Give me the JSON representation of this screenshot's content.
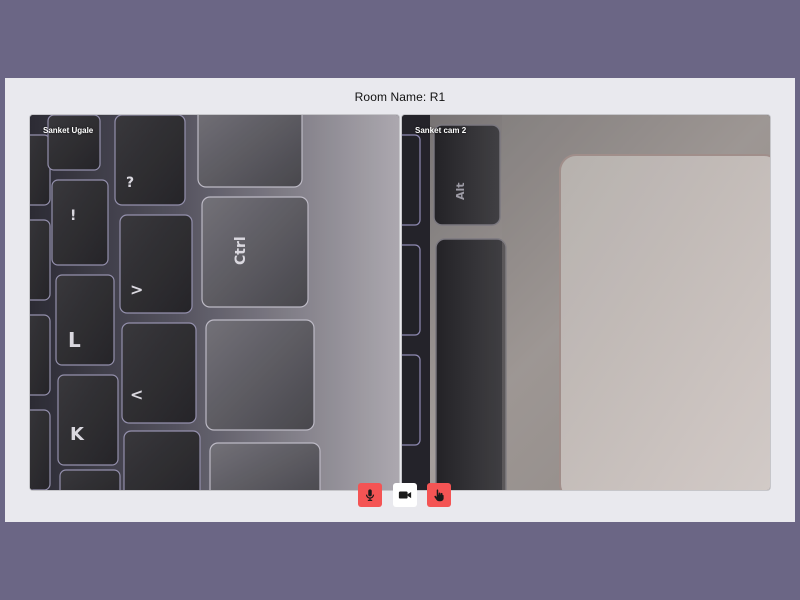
{
  "room": {
    "title": "Room Name: R1"
  },
  "participants": [
    {
      "name": "Sanket Ugale"
    },
    {
      "name": "Sanket cam 2"
    }
  ],
  "controls": {
    "mic": {
      "icon": "microphone-icon",
      "color": "#f45454",
      "state": "muted"
    },
    "camera": {
      "icon": "video-camera-icon",
      "color": "#ffffff",
      "state": "on"
    },
    "raise_hand": {
      "icon": "hand-icon",
      "color": "#f45454"
    }
  },
  "colors": {
    "page_background": "#6b6685",
    "panel_background": "#e9e9ee",
    "danger": "#f45454"
  }
}
